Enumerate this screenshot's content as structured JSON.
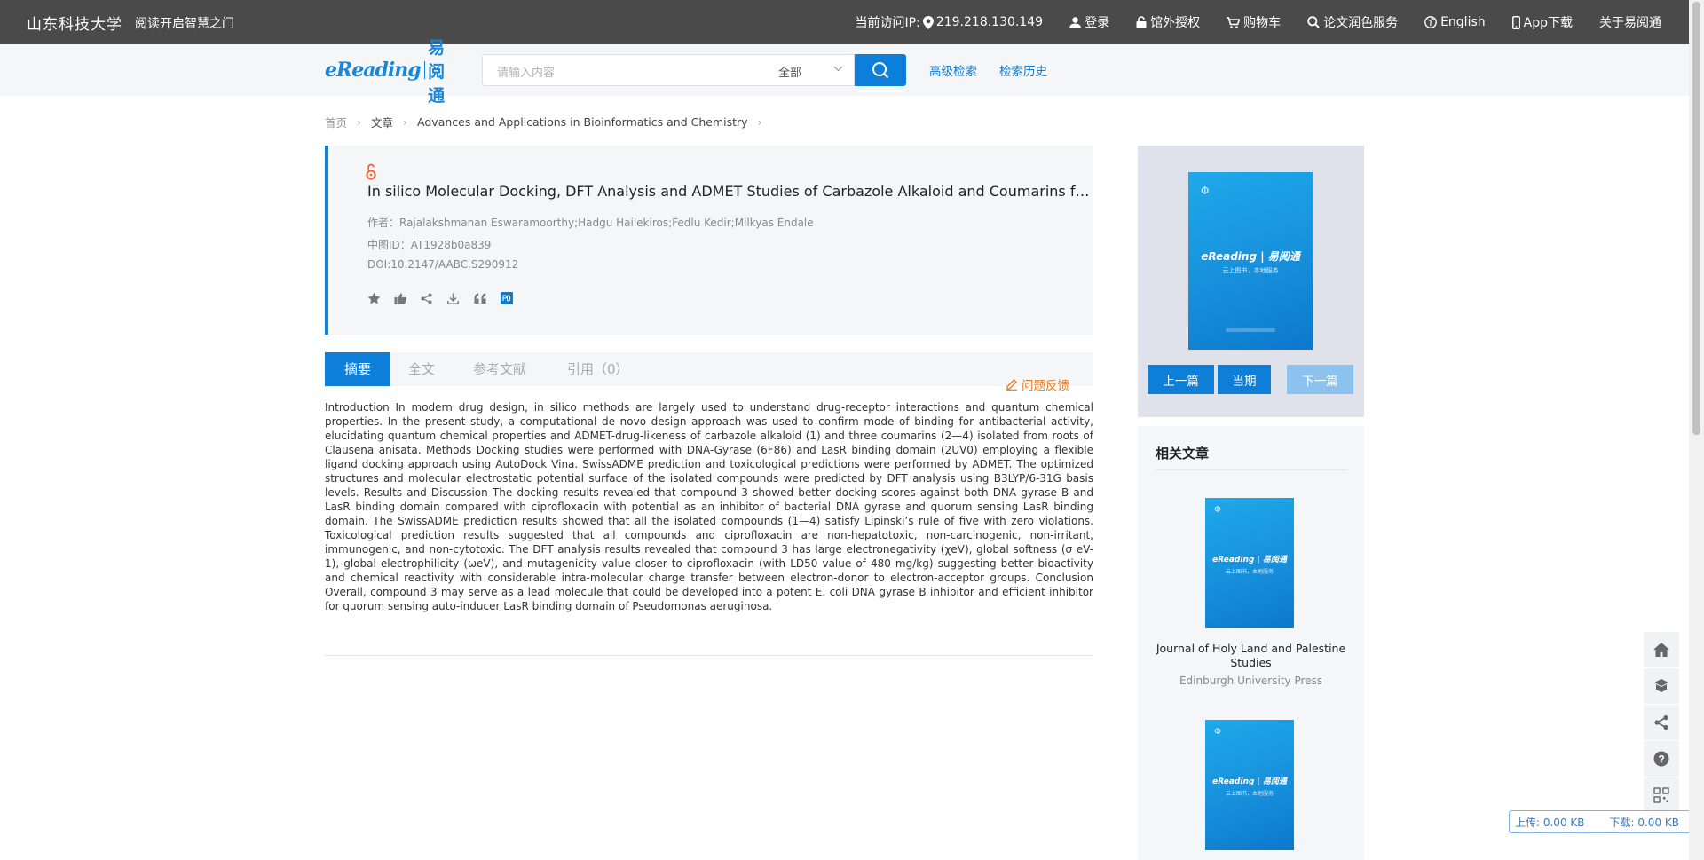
{
  "topbar": {
    "school": "山东科技大学",
    "slogan": "阅读开启智慧之门",
    "ip_label": "当前访问IP:",
    "ip_value": "219.218.130.149",
    "login": "登录",
    "offsite_auth": "馆外授权",
    "cart": "购物车",
    "polish_service": "论文润色服务",
    "language": "English",
    "app_download": "App下载",
    "about": "关于易阅通"
  },
  "logo": {
    "en": "eReading",
    "cn": "易阅通"
  },
  "search": {
    "placeholder": "请输入内容",
    "scope": "全部",
    "advanced": "高级检索",
    "history": "检索历史"
  },
  "breadcrumb": [
    "首页",
    "文章",
    "Advances and Applications in Bioinformatics and Chemistry"
  ],
  "article": {
    "oa_icon": "open-access-icon",
    "title": "In silico Molecular Docking, DFT Analysis and ADMET Studies of Carbazole Alkaloid and Coumarins from Roots of Clausena anisata: A Potent Inhibitor for Quorum Sensing",
    "authors": "作者：Rajalakshmanan Eswaramoorthy;Hadgu Hailekiros;Fedlu Kedir;Milkyas Endale",
    "clc_id": "中图ID：AT1928b0a839",
    "doi": "DOI:10.2147/AABC.S290912"
  },
  "tabs": [
    "摘要",
    "全文",
    "参考文献",
    "引用（0）"
  ],
  "feedback": "问题反馈",
  "abstract": "Introduction In modern drug design, in silico methods are largely used to understand drug-receptor interactions and quantum chemical properties. In the present study, a computational de novo design approach was used to confirm mode of binding for antibacterial activity, elucidating quantum chemical properties and ADMET-drug-likeness of carbazole alkaloid (1) and three coumarins (2—4) isolated from roots of Clausena anisata. Methods Docking studies were performed with DNA-Gyrase (6F86) and LasR binding domain (2UV0) employing a flexible ligand docking approach using AutoDock Vina. SwissADME prediction and toxicological predictions were performed by ADMET. The optimized structures and molecular electrostatic potential surface of the isolated compounds were predicted by DFT analysis using B3LYP/6-31G basis levels. Results and Discussion The docking results revealed that compound 3 showed better docking scores against both DNA gyrase B and LasR binding domain compared with ciprofloxacin with potential as an inhibitor of bacterial DNA gyrase and quorum sensing LasR binding domain. The SwissADME prediction results showed that all the isolated compounds (1—4) satisfy Lipinski’s rule of five with zero violations. Toxicological prediction results suggested that all compounds and ciprofloxacin are non-hepatotoxic, non-carcinogenic, non-irritant, immunogenic, and non-cytotoxic. The DFT analysis results revealed that compound 3 has large electronegativity (χeV), global softness (σ eV-1), global electrophilicity (ωeV), and mutagenicity value closer to ciprofloxacin (with LD50 value of 480 mg/kg) suggesting better bioactivity and chemical reactivity with considerable intra-molecular charge transfer between electron-donor to electron-acceptor groups. Conclusion Overall, compound 3 may serve as a lead molecule that could be developed into a potent E. coli DNA gyrase B inhibitor and efficient inhibitor for quorum sensing auto-inducer LasR binding domain of Pseudomonas aeruginosa.",
  "issue_nav": {
    "prev": "上一篇",
    "current": "当期",
    "next": "下一篇"
  },
  "cover_text": {
    "logo": "eReading | 易阅通",
    "sub": "云上图书，本地服务"
  },
  "related": {
    "heading": "相关文章",
    "items": [
      {
        "title": "Journal of Holy Land and Palestine Studies",
        "publisher": "Edinburgh University Press"
      }
    ]
  },
  "floatbar": [
    "home-icon",
    "book-icon",
    "share-icon",
    "help-icon",
    "qrcode-icon"
  ],
  "speed": {
    "upload": "上传: 0.00  KB",
    "download": "下载: 0.00  KB"
  },
  "colors": {
    "accent": "#0d7fd8",
    "topbar": "#4a4a4a",
    "feedback": "#e8781e"
  }
}
